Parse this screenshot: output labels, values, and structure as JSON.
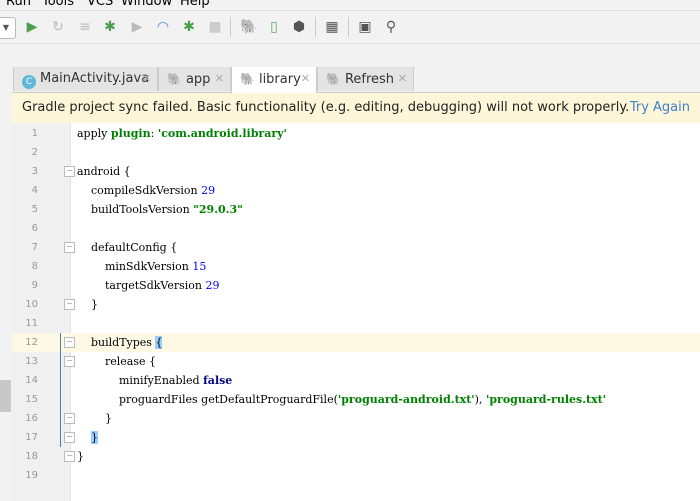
{
  "menu": [
    "Run",
    "Tools",
    "VCS",
    "Window",
    "Help"
  ],
  "toolbar": {
    "icons": [
      "run-icon",
      "rerun-icon",
      "apply-changes-icon",
      "debug-icon",
      "coverage-icon",
      "profile-icon",
      "attach-debugger-icon",
      "stop-icon",
      "gradle-sync-icon",
      "avd-manager-icon",
      "sdk-manager-icon",
      "project-structure-icon",
      "terminal-icon",
      "search-icon"
    ]
  },
  "tabs": [
    {
      "label": "MainActivity.java",
      "icon": "C"
    },
    {
      "label": "app"
    },
    {
      "label": "library"
    },
    {
      "label": "Refresh"
    }
  ],
  "banner": {
    "message": "Gradle project sync failed. Basic functionality (e.g. editing, debugging) will not work properly.",
    "action": "Try Again"
  },
  "code": [
    [
      {
        "t": "apply "
      },
      {
        "t": "plugin",
        "c": "plugin"
      },
      {
        "t": ": "
      },
      {
        "t": "'com.android.library'",
        "c": "str"
      }
    ],
    [],
    [
      {
        "t": "android {"
      }
    ],
    [
      {
        "t": "    compileSdkVersion "
      },
      {
        "t": "29",
        "c": "num"
      }
    ],
    [
      {
        "t": "    buildToolsVersion "
      },
      {
        "t": "\"29.0.3\"",
        "c": "str"
      }
    ],
    [],
    [
      {
        "t": "    defaultConfig {"
      }
    ],
    [
      {
        "t": "        minSdkVersion "
      },
      {
        "t": "15",
        "c": "num"
      }
    ],
    [
      {
        "t": "        targetSdkVersion "
      },
      {
        "t": "29",
        "c": "num"
      }
    ],
    [
      {
        "t": "    }"
      }
    ],
    [],
    [
      {
        "t": "    buildTypes "
      },
      {
        "t": "{",
        "c": "brace"
      }
    ],
    [
      {
        "t": "        release {"
      }
    ],
    [
      {
        "t": "            minifyEnabled "
      },
      {
        "t": "false",
        "c": "kw"
      }
    ],
    [
      {
        "t": "            proguardFiles getDefaultProguardFile("
      },
      {
        "t": "'proguard-android.txt'",
        "c": "str"
      },
      {
        "t": "), "
      },
      {
        "t": "'proguard-rules.txt'",
        "c": "str"
      }
    ],
    [
      {
        "t": "        }"
      }
    ],
    [
      {
        "t": "    "
      },
      {
        "t": "}",
        "c": "brace"
      }
    ],
    [
      {
        "t": "}"
      }
    ],
    []
  ]
}
